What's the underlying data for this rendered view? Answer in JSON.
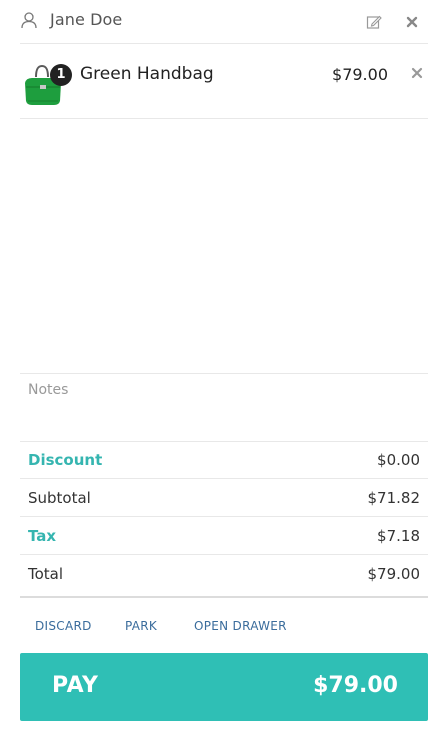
{
  "customer": {
    "name": "Jane Doe",
    "icon": "user-icon",
    "edit_icon": "edit-icon",
    "remove_icon": "close-icon"
  },
  "cart": {
    "items": [
      {
        "quantity": "1",
        "name": "Green Handbag",
        "price": "$79.00",
        "image": "green-handbag",
        "remove_icon": "close-icon"
      }
    ]
  },
  "notes": {
    "placeholder": "Notes"
  },
  "totals": {
    "discount_label": "Discount",
    "discount_value": "$0.00",
    "subtotal_label": "Subtotal",
    "subtotal_value": "$71.82",
    "tax_label": "Tax",
    "tax_value": "$7.18",
    "total_label": "Total",
    "total_value": "$79.00"
  },
  "actions": {
    "discard": "DISCARD",
    "park": "PARK",
    "open_drawer": "OPEN DRAWER"
  },
  "pay": {
    "label": "PAY",
    "amount": "$79.00"
  },
  "colors": {
    "accent": "#35b5b0",
    "pay_button": "#2fbfb5",
    "action_link": "#3a6c9c",
    "product_green": "#1e9e3e"
  }
}
